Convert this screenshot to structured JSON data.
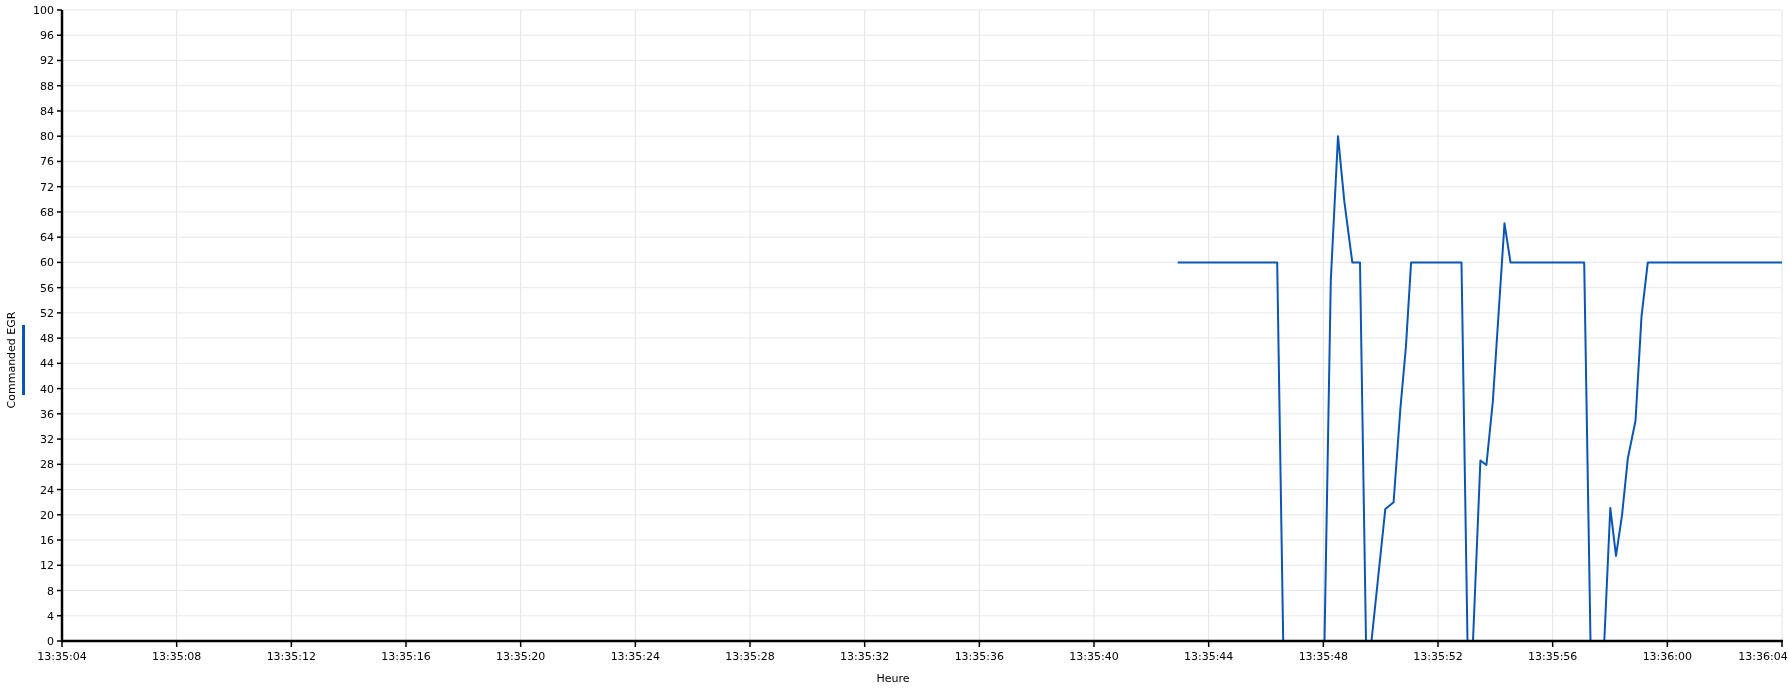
{
  "chart_data": {
    "type": "line",
    "grid": true,
    "xlabel": "Heure",
    "ylabel": "Commanded EGR",
    "xlim": [
      48904,
      48964
    ],
    "ylim": [
      0,
      100
    ],
    "x": [
      48942.92,
      48946.39,
      48946.6,
      48948.04,
      48948.26,
      48948.51,
      48948.73,
      48949.01,
      48949.28,
      48949.49,
      48949.68,
      48950.16,
      48950.45,
      48950.69,
      48950.88,
      48951.06,
      48952.82,
      48953.03,
      48953.22,
      48953.48,
      48953.69,
      48953.91,
      48954.32,
      48954.53,
      48957.1,
      48957.32,
      48957.8,
      48958.01,
      48958.21,
      48958.42,
      48958.62,
      48958.89,
      48959.1,
      48959.32,
      48964
    ],
    "series": [
      {
        "color": "#0a56b4",
        "values": [
          60,
          60,
          0,
          0,
          57.2,
          80,
          69.7,
          60,
          60,
          0,
          0,
          20.9,
          22,
          36.9,
          46.6,
          60,
          60,
          0,
          0,
          28.6,
          27.9,
          37.9,
          66.2,
          60,
          60,
          0,
          0,
          21.1,
          13.5,
          19.9,
          28.9,
          34.9,
          51.4,
          60,
          60
        ]
      }
    ],
    "xticks": [
      {
        "value": 48904,
        "label": "13:35:04"
      },
      {
        "value": 48908,
        "label": "13:35:08"
      },
      {
        "value": 48912,
        "label": "13:35:12"
      },
      {
        "value": 48916,
        "label": "13:35:16"
      },
      {
        "value": 48920,
        "label": "13:35:20"
      },
      {
        "value": 48924,
        "label": "13:35:24"
      },
      {
        "value": 48928,
        "label": "13:35:28"
      },
      {
        "value": 48932,
        "label": "13:35:32"
      },
      {
        "value": 48936,
        "label": "13:35:36"
      },
      {
        "value": 48940,
        "label": "13:35:40"
      },
      {
        "value": 48944,
        "label": "13:35:44"
      },
      {
        "value": 48948,
        "label": "13:35:48"
      },
      {
        "value": 48952,
        "label": "13:35:52"
      },
      {
        "value": 48956,
        "label": "13:35:56"
      },
      {
        "value": 48960,
        "label": "13:36:00"
      },
      {
        "value": 48964,
        "label": "13:36:04"
      }
    ],
    "yticks": [
      0,
      4,
      8,
      12,
      16,
      20,
      24,
      28,
      32,
      36,
      40,
      44,
      48,
      52,
      56,
      60,
      64,
      68,
      72,
      76,
      80,
      84,
      88,
      92,
      96,
      100
    ]
  }
}
